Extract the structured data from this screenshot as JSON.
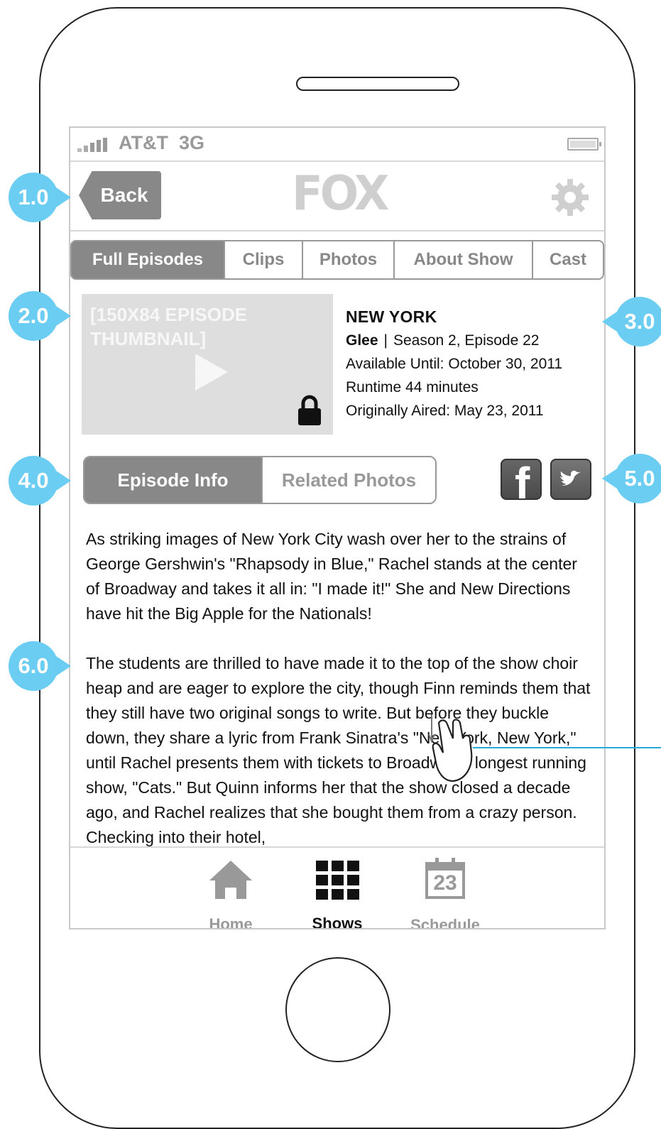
{
  "status_bar": {
    "carrier": "AT&T",
    "network": "3G"
  },
  "nav": {
    "back_label": "Back",
    "logo_text": "FOX"
  },
  "tabs": [
    {
      "label": "Full Episodes",
      "active": true
    },
    {
      "label": "Clips",
      "active": false
    },
    {
      "label": "Photos",
      "active": false
    },
    {
      "label": "About Show",
      "active": false
    },
    {
      "label": "Cast",
      "active": false
    }
  ],
  "episode": {
    "thumbnail_label": "[150X84 EPISODE THUMBNAIL]",
    "title": "NEW YORK",
    "show": "Glee",
    "separator": "|",
    "season_episode": "Season 2, Episode 22",
    "available": "Available Until: October 30, 2011",
    "runtime": "Runtime 44 minutes",
    "aired": "Originally Aired: May 23, 2011"
  },
  "segment": {
    "episode_info": "Episode Info",
    "related_photos": "Related Photos"
  },
  "description": {
    "p1": "As striking images of New York City wash over her to the strains of George Gershwin's \"Rhapsody in Blue,\" Rachel stands at the center of Broadway and takes it all in: \"I made it!\" She and New Directions have hit the Big Apple for the Nationals!",
    "p2": "The students are thrilled to have made it to the top of the show choir heap and are eager to explore the city, though Finn reminds them that they still have two original songs to write. But before they buckle down, they share a lyric from Frank Sinatra's \"New York, New York,\" until Rachel presents them with tickets to Broadway's longest running show, \"Cats.\" But Quinn informs her that the show closed a decade ago, and Rachel realizes that she bought them from a crazy person. Checking into their hotel,"
  },
  "bottom_tabs": {
    "home": "Home",
    "shows": "Shows",
    "schedule": "Schedule",
    "schedule_day": "23"
  },
  "callouts": {
    "c1": "1.0",
    "c2": "2.0",
    "c3": "3.0",
    "c4": "4.0",
    "c5": "5.0",
    "c6": "6.0"
  },
  "colors": {
    "accent": "#6ccdf3",
    "active_tab": "#888888",
    "inactive_text": "#999999",
    "annotation_line": "#28a9db"
  },
  "icons": [
    "signal-icon",
    "battery-icon",
    "gear-icon",
    "play-icon",
    "lock-icon",
    "facebook-icon",
    "twitter-icon",
    "home-icon",
    "shows-grid-icon",
    "calendar-icon",
    "hand-scroll-icon"
  ]
}
